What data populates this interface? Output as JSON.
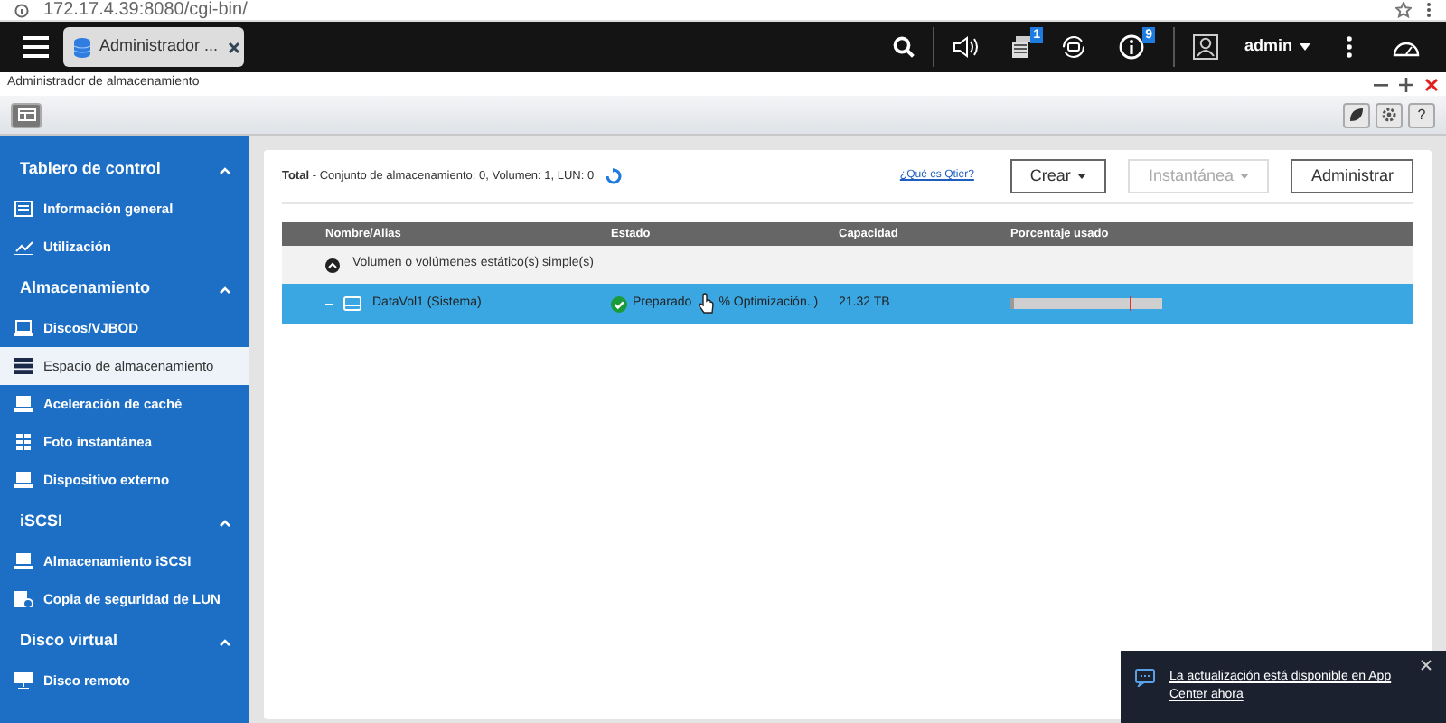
{
  "browser": {
    "url": "172.17.4.39:8080/cgi-bin/"
  },
  "topbar": {
    "tab": {
      "title": "Administrador ...",
      "selected": true
    },
    "events_badge": "1",
    "info_badge": "9",
    "user": "admin"
  },
  "window": {
    "title": "Administrador de almacenamiento",
    "help_button": "?"
  },
  "sidebar": {
    "groups": [
      {
        "label": "Tablero de control",
        "expanded": true,
        "items": [
          {
            "label": "Información general",
            "kind": "panel",
            "selected": false
          },
          {
            "label": "Utilización",
            "kind": "chart",
            "selected": false
          }
        ]
      },
      {
        "label": "Almacenamiento",
        "expanded": true,
        "items": [
          {
            "label": "Discos/VJBOD",
            "kind": "disk",
            "selected": false
          },
          {
            "label": "Espacio de almacenamiento",
            "kind": "stack",
            "selected": true
          },
          {
            "label": "Aceleración de caché",
            "kind": "drive",
            "selected": false
          },
          {
            "label": "Foto instantánea",
            "kind": "grid",
            "selected": false
          },
          {
            "label": "Dispositivo externo",
            "kind": "drive",
            "selected": false
          }
        ]
      },
      {
        "label": "iSCSI",
        "expanded": true,
        "items": [
          {
            "label": "Almacenamiento iSCSI",
            "kind": "drive",
            "selected": false
          },
          {
            "label": "Copia de seguridad de LUN",
            "kind": "backup",
            "selected": false
          }
        ]
      },
      {
        "label": "Disco virtual",
        "expanded": true,
        "items": [
          {
            "label": "Disco remoto",
            "kind": "remote",
            "selected": false
          }
        ]
      }
    ]
  },
  "summary": {
    "label": "Total",
    "text": "- Conjunto de almacenamiento: 0, Volumen: 1, LUN: 0"
  },
  "help_link": "¿Qué es Qtier?",
  "buttons": [
    {
      "label": "Crear",
      "dropdown": true,
      "disabled": false
    },
    {
      "label": "Instantánea",
      "dropdown": true,
      "disabled": true
    },
    {
      "label": "Administrar",
      "dropdown": false,
      "disabled": false
    }
  ],
  "table": {
    "columns": [
      "Nombre/Alias",
      "Estado",
      "Capacidad",
      "Porcentaje usado"
    ],
    "groups": [
      {
        "label": "Volumen o volúmenes estático(s) simple(s)",
        "expanded": true,
        "rows": [
          {
            "name": "DataVol1 (Sistema)",
            "status": "Preparado",
            "status_detail": "% Optimización..)",
            "capacity": "21.32 TB",
            "level": 0.02,
            "selected": true
          }
        ]
      }
    ]
  },
  "notification": {
    "text": "La actualización está disponible en App Center ahora"
  }
}
